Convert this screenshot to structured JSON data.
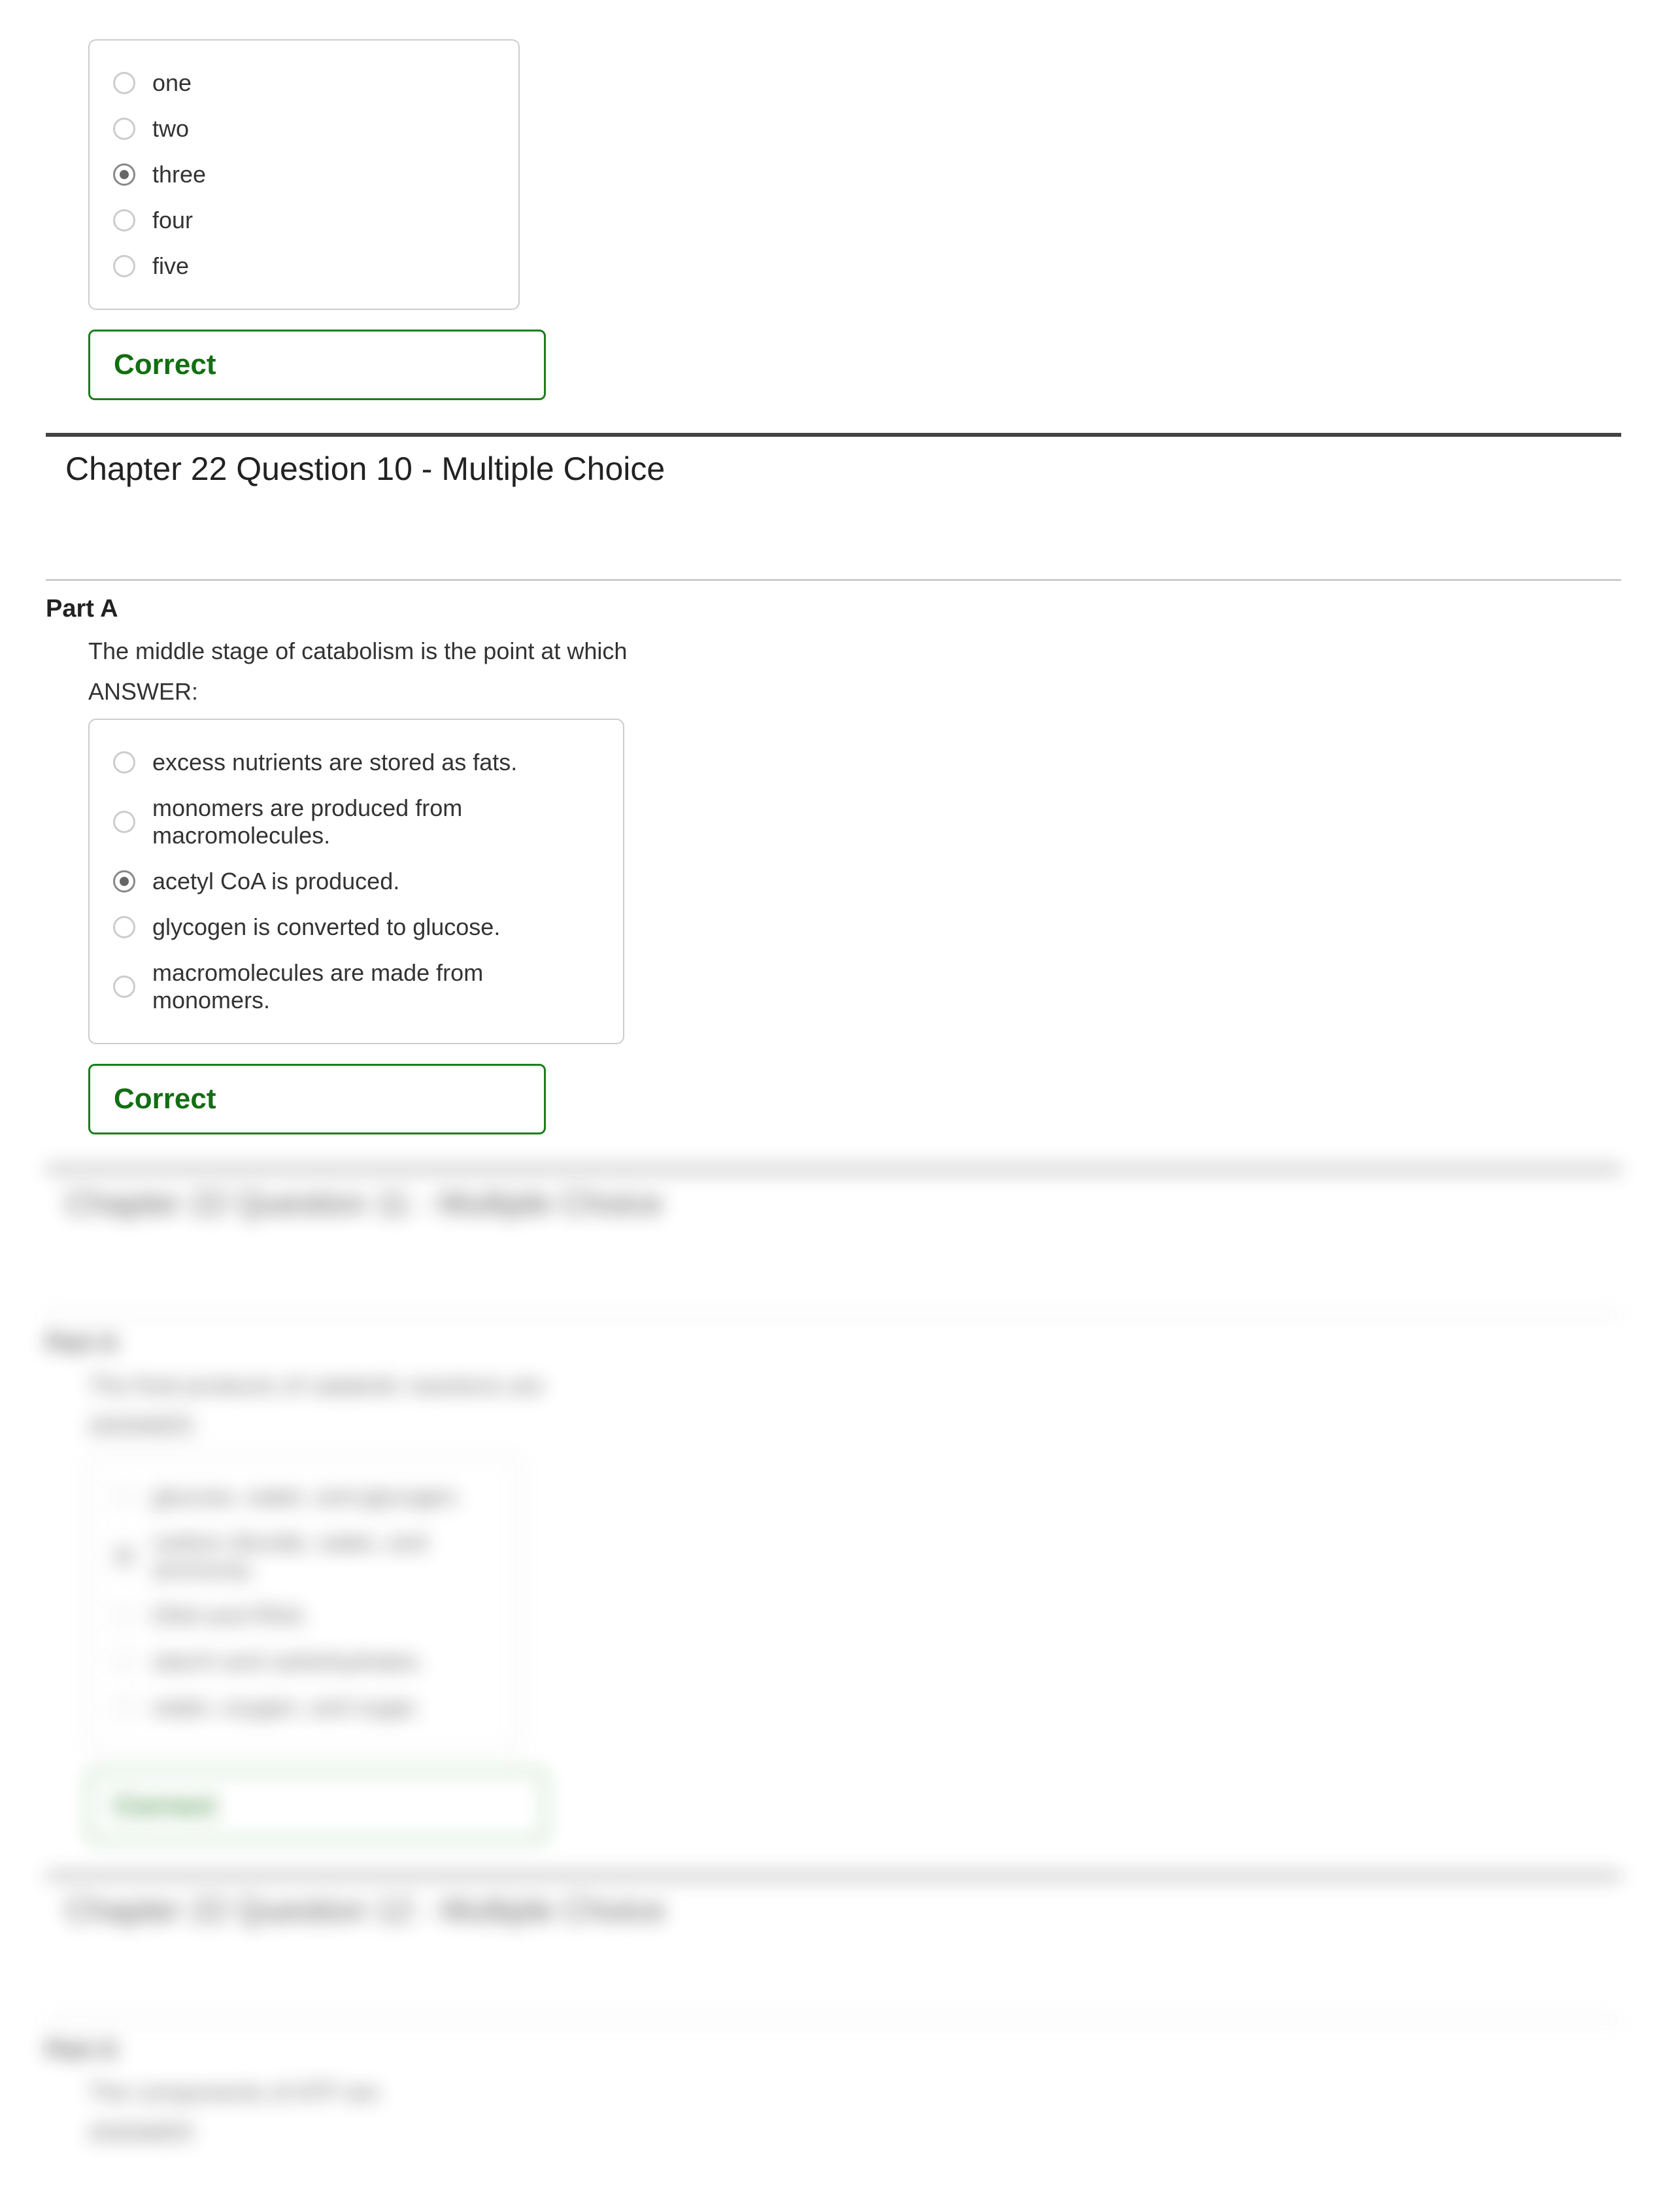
{
  "q9": {
    "options": [
      "one",
      "two",
      "three",
      "four",
      "five"
    ],
    "selected_index": 2,
    "feedback": "Correct"
  },
  "q10": {
    "title": "Chapter 22 Question 10 - Multiple Choice",
    "part_label": "Part A",
    "prompt": "The middle stage of catabolism is the point at which",
    "answer_label": "ANSWER:",
    "options": [
      "excess nutrients are stored as fats.",
      "monomers are produced from macromolecules.",
      "acetyl CoA is produced.",
      "glycogen is converted to glucose.",
      "macromolecules are made from monomers."
    ],
    "selected_index": 2,
    "feedback": "Correct"
  },
  "q11": {
    "title": "Chapter 22 Question 11 - Multiple Choice",
    "part_label": "Part A",
    "prompt": "The final products of catabolic reactions are",
    "answer_label": "ANSWER:",
    "options": [
      "glucose, water, and glycogen.",
      "carbon dioxide, water, and ammonia.",
      "DNA and RNA.",
      "starch and carbohydrates.",
      "water, oxygen, and sugar."
    ],
    "selected_index": 1,
    "feedback": "Correct"
  },
  "q12": {
    "title": "Chapter 22 Question 12 - Multiple Choice",
    "part_label": "Part A",
    "prompt": "The components of ATP are",
    "answer_label": "ANSWER:"
  }
}
